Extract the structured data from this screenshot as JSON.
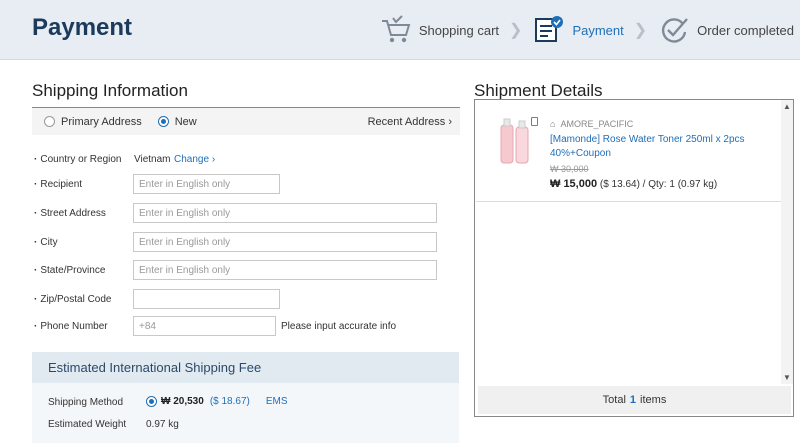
{
  "header": {
    "title": "Payment",
    "steps": [
      {
        "label": "Shopping cart",
        "icon": "cart-icon",
        "active": false
      },
      {
        "label": "Payment",
        "icon": "payment-form-icon",
        "active": true
      },
      {
        "label": "Order completed",
        "icon": "order-completed-icon",
        "active": false
      }
    ]
  },
  "shipping": {
    "title": "Shipping Information",
    "address_options": {
      "primary": "Primary Address",
      "new": "New",
      "selected": "New"
    },
    "recent_address": "Recent Address",
    "fields": {
      "country": {
        "label": "Country or Region",
        "value": "Vietnam",
        "change": "Change"
      },
      "recipient": {
        "label": "Recipient",
        "placeholder": "Enter in English only"
      },
      "street": {
        "label": "Street Address",
        "placeholder": "Enter in English only"
      },
      "city": {
        "label": "City",
        "placeholder": "Enter in English only"
      },
      "state": {
        "label": "State/Province",
        "placeholder": "Enter in English only"
      },
      "zip": {
        "label": "Zip/Postal Code",
        "placeholder": ""
      },
      "phone": {
        "label": "Phone Number",
        "prefix": "+84",
        "hint": "Please input accurate info"
      }
    }
  },
  "fee": {
    "title": "Estimated International Shipping Fee",
    "method_label": "Shipping Method",
    "method_amount": "₩ 20,530",
    "method_usd": "($ 18.67)",
    "method_name": "EMS",
    "weight_label": "Estimated Weight",
    "weight_value": "0.97 kg"
  },
  "shipment": {
    "title": "Shipment Details",
    "item": {
      "seller": "AMORE_PACIFIC",
      "name": "[Mamonde] Rose Water Toner 250ml x 2pcs 40%+Coupon",
      "original_price": "₩ 30,000",
      "price": "₩ 15,000",
      "price_usd": "($ 13.64)",
      "qty": "Qty: 1",
      "weight": "(0.97 kg)"
    },
    "total_prefix": "Total",
    "total_count": "1",
    "total_suffix": "items"
  },
  "colors": {
    "accent": "#1f6fb8",
    "header_bg": "#e8edf3",
    "title": "#1b3a5c"
  }
}
